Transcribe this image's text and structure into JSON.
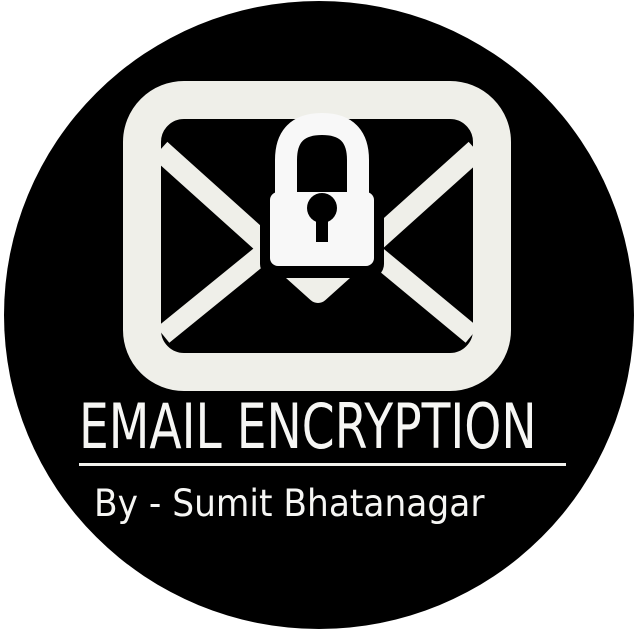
{
  "logo": {
    "title": "EMAIL ENCRYPTION",
    "byline": "By - Sumit Bhatanagar",
    "emblem_icon": "envelope-lock-icon"
  },
  "colors": {
    "background": "#ffffff",
    "disc": "#000000",
    "envelope": "#efefe9",
    "lock": "#f8f8f8",
    "text": "#f6f6f4"
  }
}
